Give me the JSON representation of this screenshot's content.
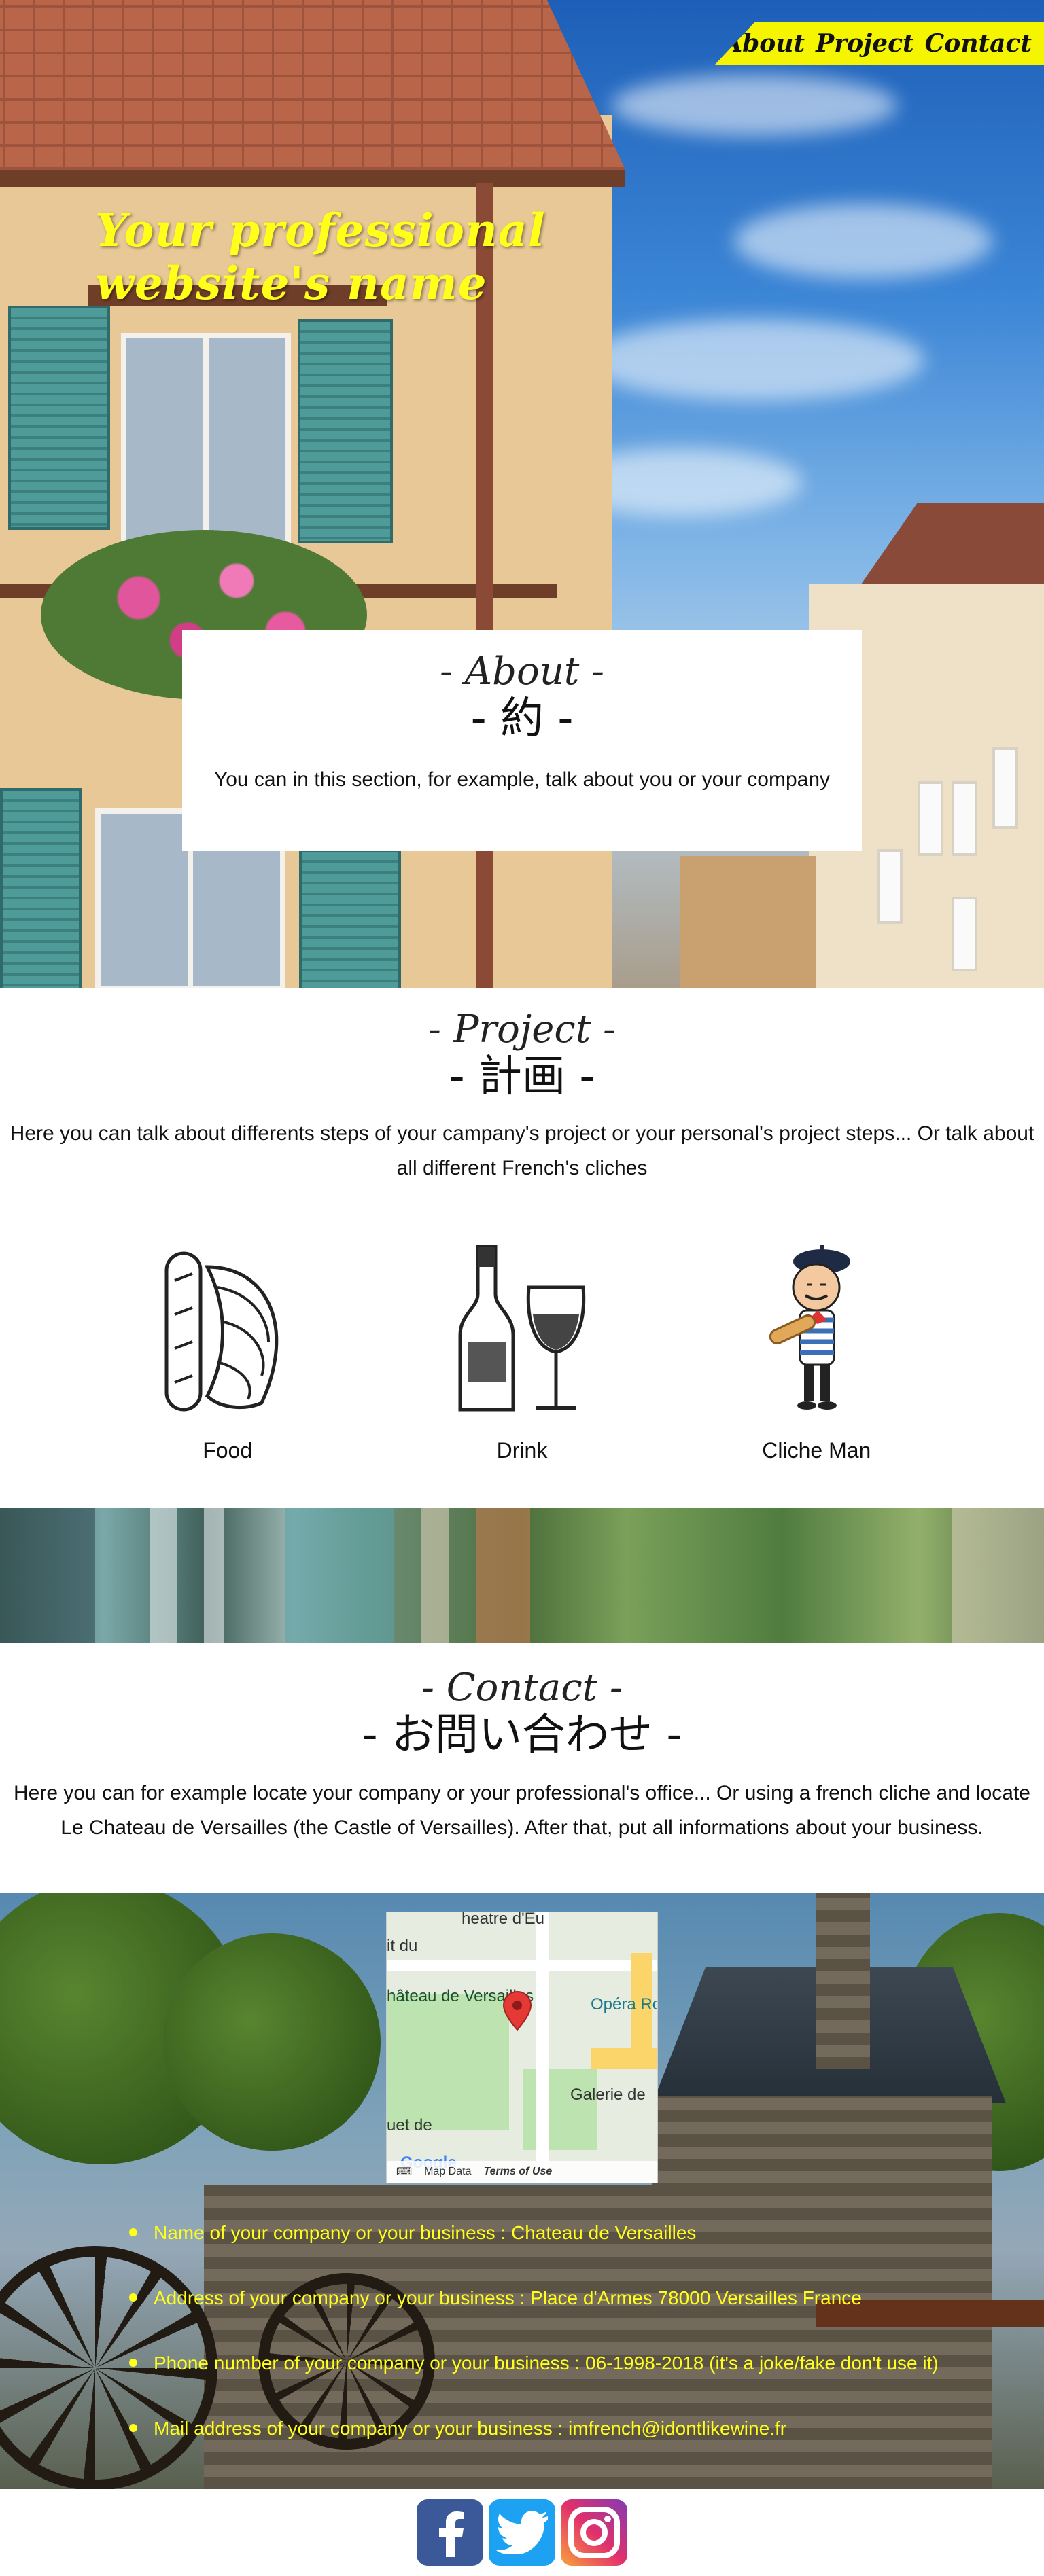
{
  "nav": {
    "links": [
      "About",
      "Project",
      "Contact"
    ]
  },
  "site_title": "Your professional website's name",
  "about": {
    "title": "- About -",
    "title_jp": "- 約 -",
    "body": "You can in this section, for example, talk about you or your company"
  },
  "project": {
    "title": "- Project -",
    "title_jp": "- 計画 -",
    "body": "Here you can talk about differents steps of your campany's project or your personal's project steps... Or talk about all different French's cliches",
    "cards": [
      {
        "label": "Food",
        "icon": "croissant-baguette-icon"
      },
      {
        "label": "Drink",
        "icon": "wine-bottle-glass-icon"
      },
      {
        "label": "Cliche Man",
        "icon": "french-man-icon"
      }
    ]
  },
  "contact": {
    "title": "- Contact -",
    "title_jp": "- お問い合わせ -",
    "body": "Here you can for example locate your company or your professional's office... Or using a french cliche and locate Le Chateau de Versailles (the Castle of Versailles). After that, put all informations about your business."
  },
  "map": {
    "labels": [
      "heatre d'Eu",
      "it du",
      "hâteau de Versailles",
      "Opéra Roy",
      "Galerie de",
      "uet de",
      "Google"
    ],
    "footer_data": "Map Data",
    "footer_terms": "Terms of Use"
  },
  "info": [
    "Name of your company or your business : Chateau de Versailles",
    "Address of your company or your business : Place d'Armes 78000 Versailles France",
    "Phone number of your company or your business : 06-1998-2018 (it's a joke/fake don't use it)",
    "Mail address of your company or your business : imfrench@idontlikewine.fr"
  ],
  "social": [
    "facebook-icon",
    "twitter-icon",
    "instagram-icon"
  ],
  "colors": {
    "accent_yellow": "#f5f500",
    "title_yellow": "#ffff1a",
    "facebook": "#3b5998",
    "twitter": "#1da1f2",
    "instagram": "#c13584"
  }
}
